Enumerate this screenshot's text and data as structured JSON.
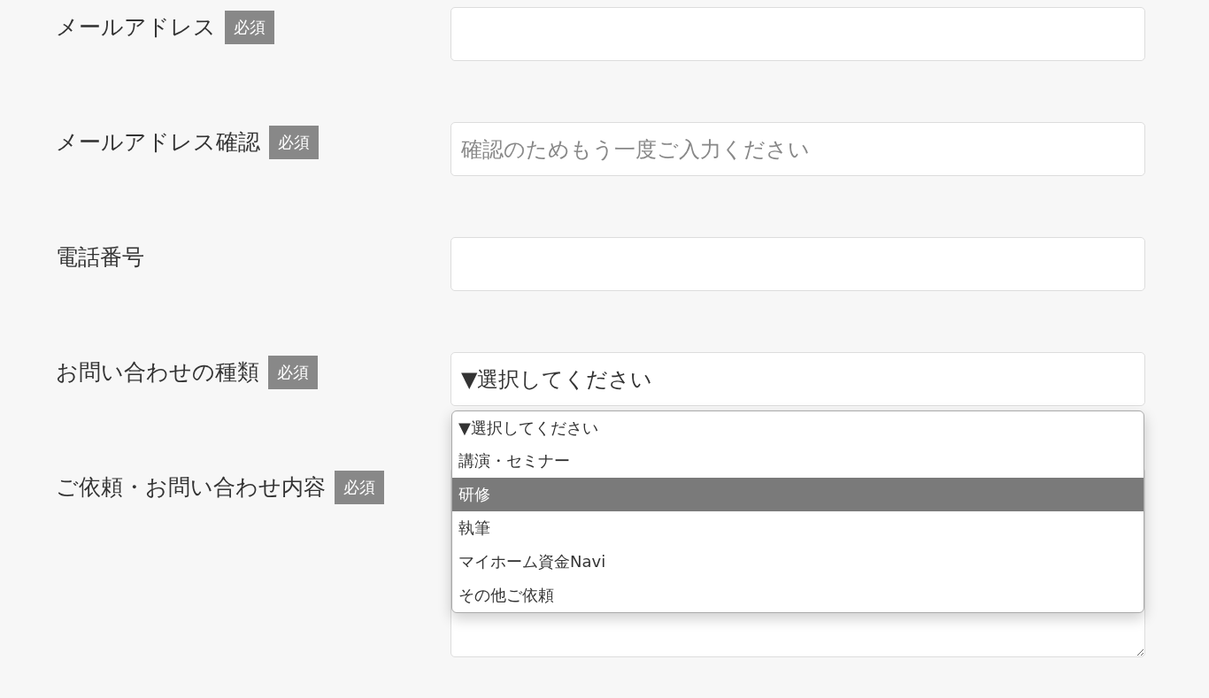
{
  "fields": [
    {
      "kind": "text",
      "label": "メールアドレス",
      "badge": "必須"
    },
    {
      "kind": "text",
      "label": "メールアドレス確認",
      "badge": "必須",
      "placeholder": "確認のためもう一度ご入力ください"
    },
    {
      "kind": "text",
      "label": "電話番号"
    },
    {
      "kind": "select",
      "label": "お問い合わせの種類",
      "badge": "必須",
      "value": "▼選択してください",
      "expanded": true,
      "options": [
        {
          "label": "▼選択してください",
          "highlighted": false
        },
        {
          "label": "講演・セミナー",
          "highlighted": false
        },
        {
          "label": "研修",
          "highlighted": true
        },
        {
          "label": "執筆",
          "highlighted": false
        },
        {
          "label": "マイホーム資金Navi",
          "highlighted": false
        },
        {
          "label": "その他ご依頼",
          "highlighted": false
        }
      ]
    },
    {
      "kind": "textarea",
      "label": "ご依頼・お問い合わせ内容",
      "badge": "必須"
    }
  ]
}
